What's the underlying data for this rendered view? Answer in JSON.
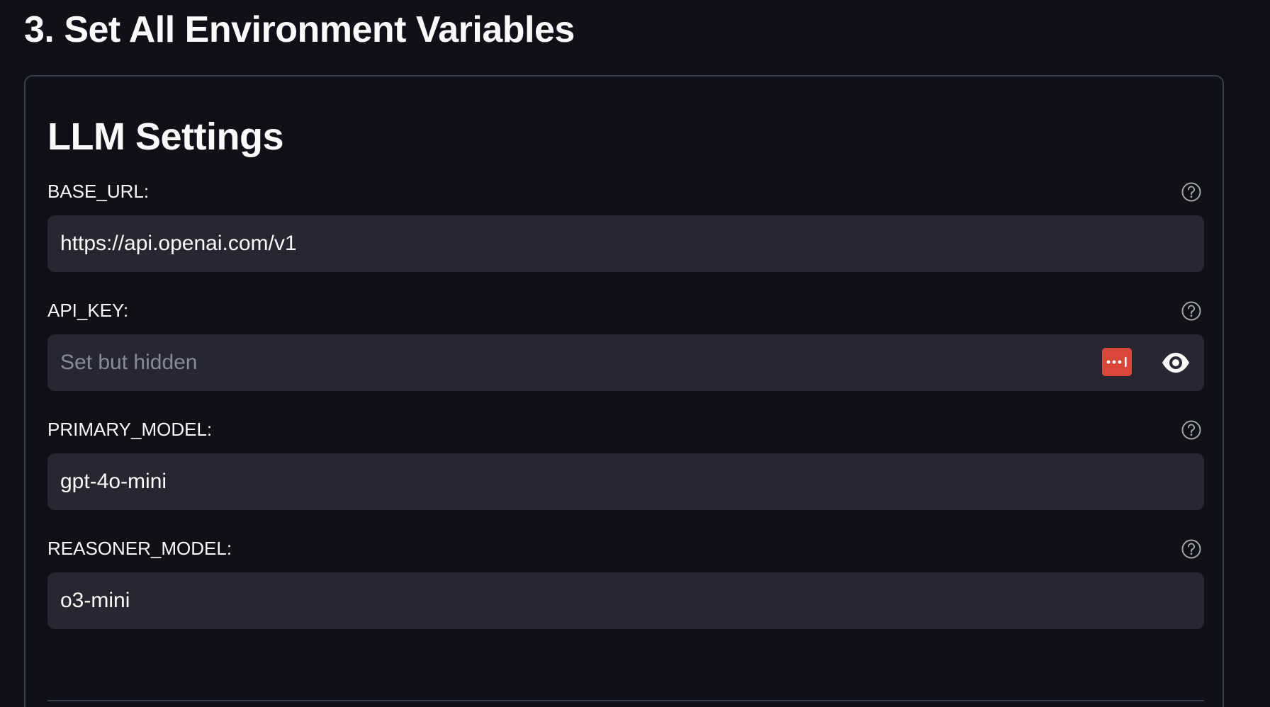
{
  "section": {
    "title": "3. Set All Environment Variables"
  },
  "card": {
    "title": "LLM Settings"
  },
  "fields": [
    {
      "label": "BASE_URL:",
      "value": "https://api.openai.com/v1",
      "placeholder": "",
      "help_icon": "question-circle-icon"
    },
    {
      "label": "API_KEY:",
      "value": "",
      "placeholder": "Set but hidden",
      "help_icon": "question-circle-icon",
      "extra_icons": [
        "password-manager-icon",
        "eye-icon"
      ]
    },
    {
      "label": "PRIMARY_MODEL:",
      "value": "gpt-4o-mini",
      "placeholder": "",
      "help_icon": "question-circle-icon"
    },
    {
      "label": "REASONER_MODEL:",
      "value": "o3-mini",
      "placeholder": "",
      "help_icon": "question-circle-icon"
    }
  ],
  "colors": {
    "background": "#0f1117",
    "input_background": "#262730",
    "border": "#3a3d47",
    "text": "#fafafa",
    "placeholder": "#8a8c95",
    "password_manager_accent": "#d9463a"
  }
}
